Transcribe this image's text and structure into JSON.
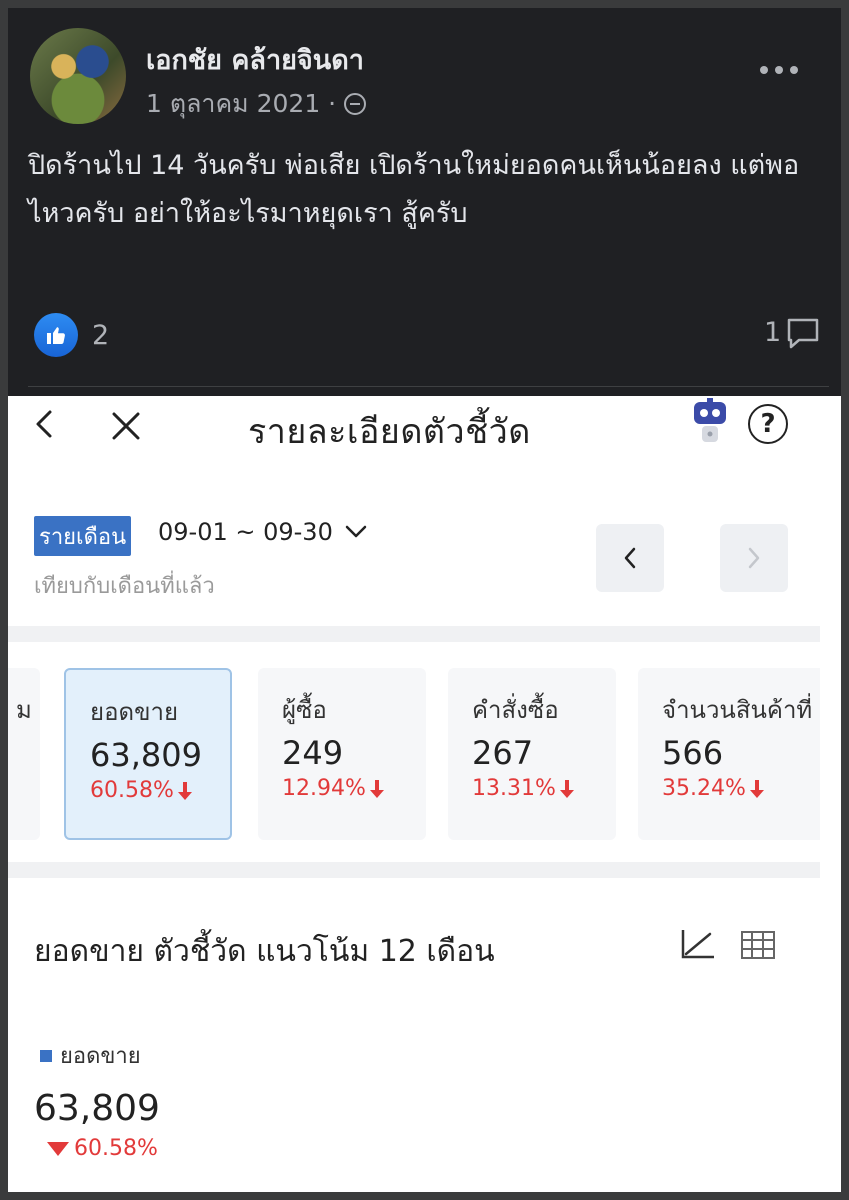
{
  "post": {
    "author": "เอกชัย คล้ายจินดา",
    "date": "1 ตุลาคม 2021 ·",
    "text": "ปิดร้านไป 14 วันครับ พ่อเสีย เปิดร้านใหม่ยอดคนเห็นน้อยลง แต่พอไหวครับ อย่าให้อะไรมาหยุดเรา สู้ครับ",
    "like_count": "2",
    "comment_count": "1",
    "icons": [
      "avatar",
      "globe-icon",
      "more-icon",
      "like-icon",
      "comment-icon"
    ]
  },
  "app": {
    "title": "รายละเอียดตัวชี้วัด",
    "icons": [
      "back-icon",
      "close-icon",
      "robot-icon",
      "help-icon"
    ],
    "help_label": "?",
    "period_label": "รายเดือน",
    "date_range": "09-01 ~ 09-30",
    "compare_text": "เทียบกับเดือนที่แล้ว",
    "partial_card_label": "ม",
    "metrics": [
      {
        "label": "ยอดขาย",
        "value": "63,809",
        "delta": "60.58%",
        "active": true
      },
      {
        "label": "ผู้ซื้อ",
        "value": "249",
        "delta": "12.94%",
        "active": false
      },
      {
        "label": "คำสั่งซื้อ",
        "value": "267",
        "delta": "13.31%",
        "active": false
      },
      {
        "label": "จำนวนสินค้าที่",
        "value": "566",
        "delta": "35.24%",
        "active": false
      }
    ],
    "trend": {
      "heading": "ยอดขาย ตัวชี้วัด แนวโน้ม 12 เดือน",
      "legend": "ยอดขาย",
      "value": "63,809",
      "delta": "60.58%"
    },
    "colors": {
      "accent": "#3a72c4",
      "negative": "#e23a3a",
      "active_card_bg": "#e3f0fb"
    }
  }
}
